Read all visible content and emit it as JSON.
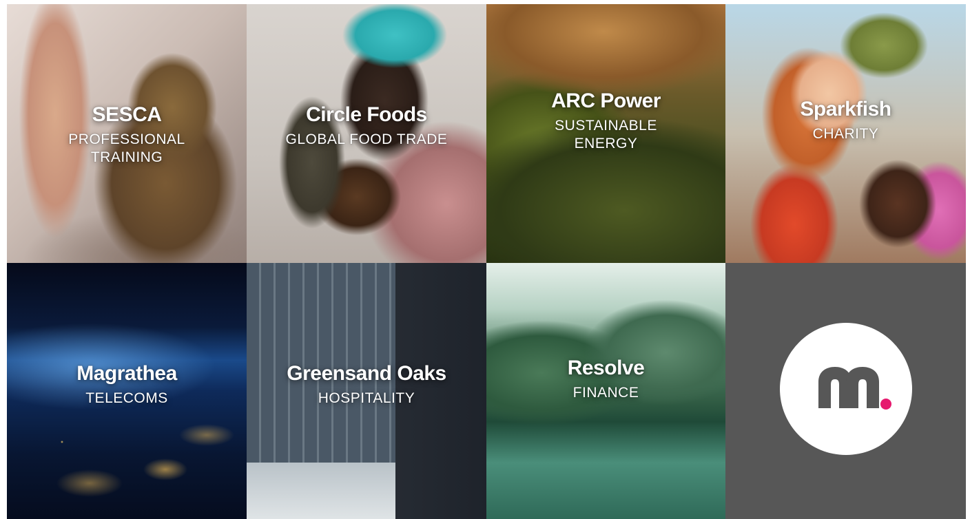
{
  "tiles": [
    {
      "name": "SESCA",
      "sector": "PROFESSIONAL\nTRAINING"
    },
    {
      "name": "Circle Foods",
      "sector": "GLOBAL FOOD TRADE"
    },
    {
      "name": "ARC Power",
      "sector": "SUSTAINABLE\nENERGY"
    },
    {
      "name": "Sparkfish",
      "sector": "CHARITY"
    },
    {
      "name": "Magrathea",
      "sector": "TELECOMS"
    },
    {
      "name": "Greensand Oaks",
      "sector": "HOSPITALITY"
    },
    {
      "name": "Resolve",
      "sector": "FINANCE"
    }
  ],
  "logo": {
    "icon": "m-brand-logo-icon",
    "disc_color": "#ffffff",
    "mark_color": "#575757",
    "dot_color": "#e6196e",
    "tile_color": "#575757"
  }
}
